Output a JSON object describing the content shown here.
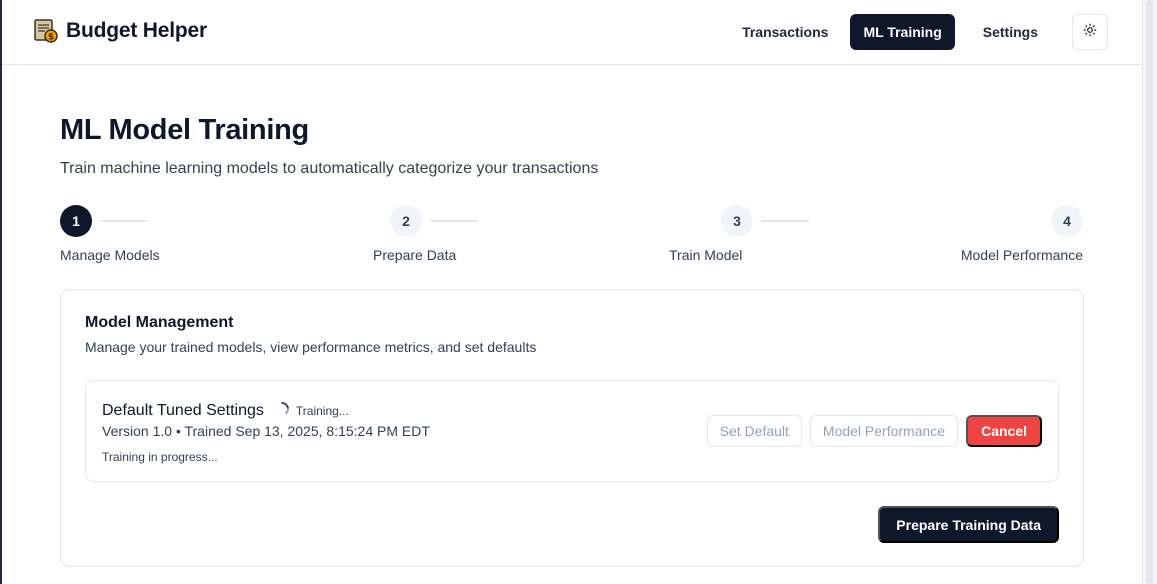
{
  "app": {
    "title": "Budget Helper",
    "logo_icon": "ledger-money-icon"
  },
  "nav": {
    "items": [
      {
        "label": "Transactions",
        "active": false
      },
      {
        "label": "ML Training",
        "active": true
      },
      {
        "label": "Settings",
        "active": false
      }
    ],
    "theme_toggle_icon": "sun-icon"
  },
  "page": {
    "title": "ML Model Training",
    "subtitle": "Train machine learning models to automatically categorize your transactions"
  },
  "stepper": {
    "current_step": 1,
    "steps": [
      {
        "number": "1",
        "label": "Manage Models"
      },
      {
        "number": "2",
        "label": "Prepare Data"
      },
      {
        "number": "3",
        "label": "Train Model"
      },
      {
        "number": "4",
        "label": "Model Performance"
      }
    ]
  },
  "management": {
    "title": "Model Management",
    "description": "Manage your trained models, view performance metrics, and set defaults",
    "model": {
      "name": "Default Tuned Settings",
      "training_badge": "Training...",
      "meta": "Version 1.0 • Trained Sep 13, 2025, 8:15:24 PM EDT",
      "status": "Training in progress..."
    },
    "actions": {
      "set_default": "Set Default",
      "model_performance": "Model Performance",
      "cancel": "Cancel"
    },
    "prepare_button": "Prepare Training Data"
  },
  "colors": {
    "primary": "#0f172a",
    "danger": "#ef4444",
    "border": "#e5e7eb"
  }
}
